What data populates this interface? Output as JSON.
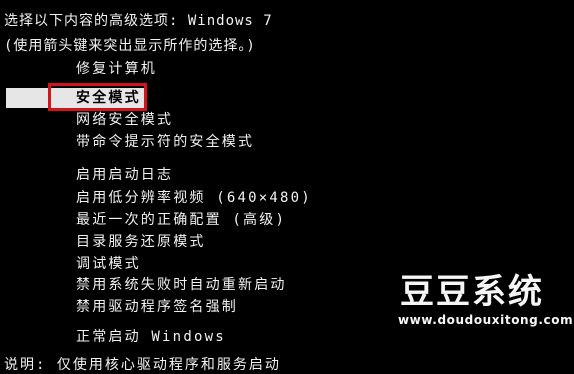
{
  "header": {
    "line1": "选择以下内容的高级选项: Windows 7",
    "line2": "(使用箭头键来突出显示所作的选择。)"
  },
  "menu": {
    "items": [
      {
        "label": "修复计算机"
      },
      {
        "label": "安全模式",
        "selected": true
      },
      {
        "label": "网络安全模式"
      },
      {
        "label": "带命令提示符的安全模式"
      },
      {
        "label": "启用启动日志"
      },
      {
        "label": "启用低分辨率视频 (640×480)"
      },
      {
        "label": "最近一次的正确配置 (高级)"
      },
      {
        "label": "目录服务还原模式"
      },
      {
        "label": "调试模式"
      },
      {
        "label": "禁用系统失败时自动重新启动"
      },
      {
        "label": "禁用驱动程序签名强制"
      },
      {
        "label": "正常启动 Windows"
      }
    ]
  },
  "footer": {
    "text": "说明: 仅使用核心驱动程序和服务启动"
  },
  "watermark": {
    "title": "豆豆系统",
    "url": "www.doudouxitong.com"
  },
  "colors": {
    "background": "#000000",
    "text": "#f2f2f2",
    "selection_bar": "#e6e6e6",
    "highlight_box": "#d2141c"
  }
}
